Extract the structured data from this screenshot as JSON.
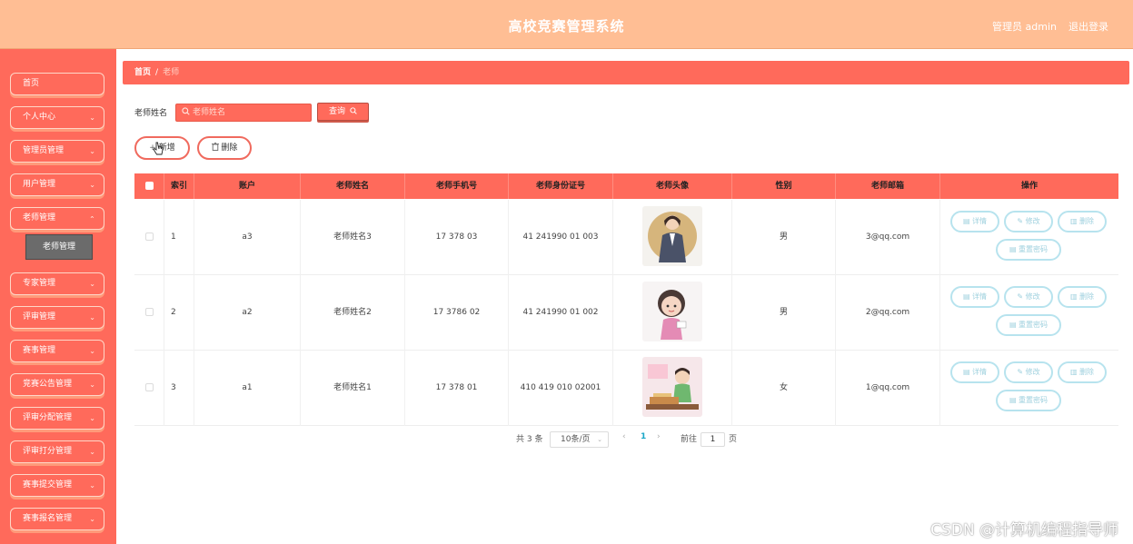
{
  "header": {
    "title": "高校竞赛管理系统",
    "user": "管理员 admin",
    "logout": "退出登录"
  },
  "sidebar": {
    "items": [
      {
        "label": "首页"
      },
      {
        "label": "个人中心"
      },
      {
        "label": "管理员管理"
      },
      {
        "label": "用户管理"
      },
      {
        "label": "老师管理"
      },
      {
        "label": "专家管理"
      },
      {
        "label": "评审管理"
      },
      {
        "label": "赛事管理"
      },
      {
        "label": "竞赛公告管理"
      },
      {
        "label": "评审分配管理"
      },
      {
        "label": "评审打分管理"
      },
      {
        "label": "赛事提交管理"
      },
      {
        "label": "赛事报名管理"
      }
    ],
    "chevron": "⌄",
    "submenu": "老师管理"
  },
  "breadcrumb": {
    "home": "首页",
    "sep": "/",
    "current": "老师"
  },
  "search": {
    "label": "老师姓名",
    "placeholder": "老师姓名",
    "button": "查询"
  },
  "actions": {
    "add": "新增",
    "delete": "删除"
  },
  "table": {
    "headers": [
      "索引",
      "账户",
      "老师姓名",
      "老师手机号",
      "老师身份证号",
      "老师头像",
      "性别",
      "老师邮箱",
      "操作"
    ],
    "rows": [
      {
        "index": "1",
        "account": "a3",
        "name": "老师姓名3",
        "phone": "17  378  03",
        "idcard": "41  241990 01  003",
        "gender": "男",
        "email": "3@qq.com"
      },
      {
        "index": "2",
        "account": "a2",
        "name": "老师姓名2",
        "phone": "17  3786  02",
        "idcard": "41  241990  01  002",
        "gender": "男",
        "email": "2@qq.com"
      },
      {
        "index": "3",
        "account": "a1",
        "name": "老师姓名1",
        "phone": "17  378  01",
        "idcard": "410  419  010  02001",
        "gender": "女",
        "email": "1@qq.com"
      }
    ],
    "row_actions": {
      "detail": "详情",
      "edit": "修改",
      "delete": "删除",
      "reset": "重置密码"
    }
  },
  "pagination": {
    "total": "共 3 条",
    "page_size": "10条/页",
    "current": "1",
    "goto": "前往",
    "goto_value": "1",
    "page_suffix": "页",
    "prev": "‹",
    "next": "›"
  },
  "watermark": "CSDN @计算机编程指导师",
  "colors": {
    "accent": "#ff6a5b",
    "header": "#ffbe94",
    "action_border": "#b7e3ee"
  }
}
